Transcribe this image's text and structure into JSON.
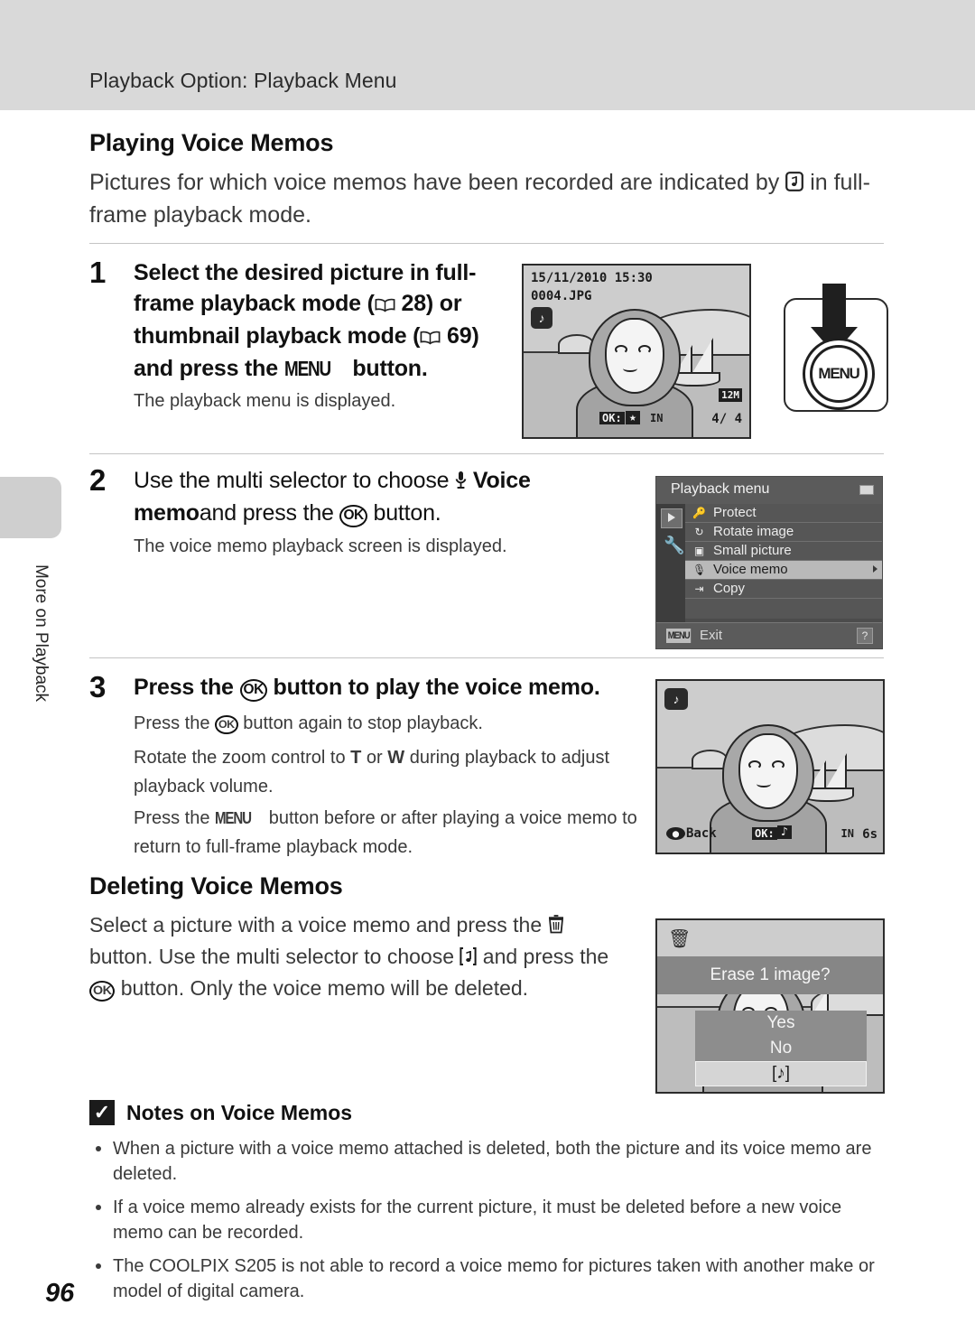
{
  "header": {
    "running_title": "Playback Option: Playback Menu"
  },
  "side_tab": {
    "label": "More on Playback"
  },
  "page": {
    "number": "96"
  },
  "sections": {
    "playing": {
      "title": "Playing Voice Memos",
      "intro_before": "Pictures for which voice memos have been recorded are indicated by",
      "intro_after": "in full-frame playback mode.",
      "voice_memo_icon": "voice-memo-icon"
    },
    "deleting": {
      "title": "Deleting Voice Memos",
      "para_1": "Select a picture with a voice memo and press the",
      "trash_icon": "trash-icon",
      "para_2": "button. Use the multi selector to choose",
      "memo_icon": "voice-memo-bracket-icon",
      "para_3": "and press",
      "para_4": "the",
      "ok_label": "OK",
      "para_5": "button. Only the voice memo will be deleted."
    }
  },
  "steps": [
    {
      "num": "1",
      "head_line1": "Select the desired picture in full-",
      "head_line2_a": "frame playback mode (",
      "head_line2_page": "28",
      "head_line2_b": ") or",
      "head_line3_a": "thumbnail playback mode (",
      "head_line3_page": "69",
      "head_line3_b": ")",
      "head_line4_a": "and press the",
      "menu_label": "MENU",
      "head_line4_b": "button.",
      "body": "The playback menu is displayed."
    },
    {
      "num": "2",
      "head_line1_a": "Use the multi selector to choose",
      "head_line1_b": "Voice",
      "head_line2_a": "memo",
      "head_line2_b": "and press the",
      "ok_label": "OK",
      "head_line2_c": "button.",
      "body": "The voice memo playback screen is displayed."
    },
    {
      "num": "3",
      "head_a": "Press the",
      "ok_label": "OK",
      "head_b": "button to play the voice memo.",
      "body_1_a": "Press the",
      "body_1_b": "button again to stop playback.",
      "body_2_a": "Rotate the zoom control to",
      "body_2_T": "T",
      "body_2_or": "or",
      "body_2_W": "W",
      "body_2_b": "during playback to",
      "body_2_c": "adjust playback volume.",
      "body_3_a": "Press the",
      "menu_label": "MENU",
      "body_3_b": "button before or after playing a voice",
      "body_3_c": "memo to return to full-frame playback mode."
    }
  ],
  "screens": {
    "full_frame": {
      "date": "15/11/2010 15:30",
      "filename": "0004.JPG",
      "voice_memo_icon": "voice-memo-icon",
      "image_size": "12M",
      "frame_counter": "4/  4",
      "ok_hint": "OK:",
      "star_icon": "star-icon",
      "memory_icon": "IN"
    },
    "playback_menu": {
      "title": "Playback menu",
      "battery_icon": "battery-icon",
      "tab_playback_icon": "playback-tab-icon",
      "tab_setup_icon": "wrench-tab-icon",
      "items": [
        {
          "label": "Protect",
          "icon": "key-icon",
          "selected": false
        },
        {
          "label": "Rotate image",
          "icon": "rotate-icon",
          "selected": false
        },
        {
          "label": "Small picture",
          "icon": "small-picture-icon",
          "selected": false
        },
        {
          "label": "Voice memo",
          "icon": "microphone-icon",
          "selected": true
        },
        {
          "label": "Copy",
          "icon": "copy-icon",
          "selected": false
        }
      ],
      "exit_badge": "MENU",
      "exit_label": "Exit",
      "help_badge": "?"
    },
    "voice_playback": {
      "voice_memo_icon": "voice-memo-icon",
      "back_label": "Back",
      "ok_hint": "OK:",
      "note_icon": "music-note-icon",
      "memory_icon": "IN",
      "duration": "6s"
    },
    "erase_dialog": {
      "trash_icon": "trash-icon",
      "message": "Erase 1 image?",
      "options": [
        {
          "label": "Yes",
          "selected": false
        },
        {
          "label": "No",
          "selected": false
        },
        {
          "label": "[♪]",
          "selected": true
        }
      ]
    }
  },
  "notes": {
    "icon": "warning-check-icon",
    "title": "Notes on Voice Memos",
    "items": [
      "When a picture with a voice memo attached is deleted, both the picture and its voice memo are deleted.",
      "If a voice memo already exists for the current picture, it must be deleted before a new voice memo can be recorded.",
      "The COOLPIX S205 is not able to record a voice memo for pictures taken with another make or model of digital camera."
    ]
  },
  "colors": {
    "header_band": "#d9d9d9",
    "side_tab": "#cfcfcf",
    "menu_bg": "#4c4c4c",
    "menu_selected": "#b9b9b9",
    "text": "#3a3a3a"
  }
}
